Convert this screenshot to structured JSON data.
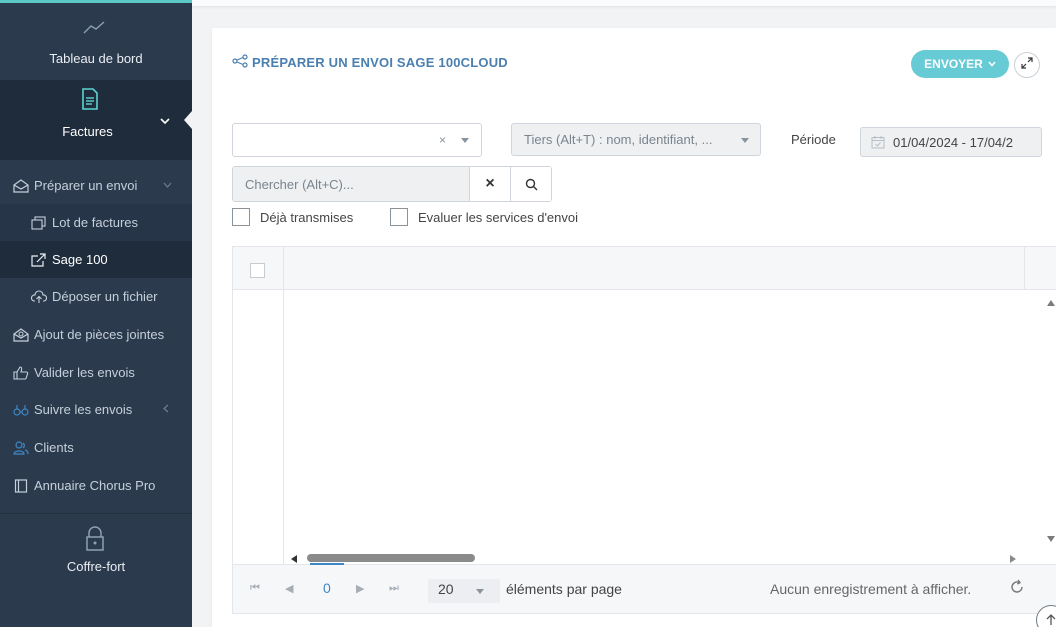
{
  "sidebar": {
    "dashboard_label": "Tableau de bord",
    "factures_label": "Factures",
    "items": [
      {
        "label": "Préparer un envoi",
        "icon": "envelope-open-icon"
      },
      {
        "label": "Lot de factures",
        "icon": "stack-icon"
      },
      {
        "label": "Sage 100",
        "icon": "export-icon"
      },
      {
        "label": "Déposer un fichier",
        "icon": "cloud-upload-icon"
      },
      {
        "label": "Ajout de pièces jointes",
        "icon": "envelope-attach-icon"
      },
      {
        "label": "Valider les envois",
        "icon": "thumb-up-icon"
      },
      {
        "label": "Suivre les envois",
        "icon": "binoculars-icon"
      },
      {
        "label": "Clients",
        "icon": "users-icon"
      },
      {
        "label": "Annuaire Chorus Pro",
        "icon": "book-icon"
      }
    ],
    "vault_label": "Coffre-fort"
  },
  "panel": {
    "title": "PRÉPARER UN ENVOI SAGE 100CLOUD",
    "send_button": "ENVOYER",
    "first_select": {
      "value": "",
      "clear": "×"
    },
    "tiers_placeholder": "Tiers (Alt+T) : nom, identifiant, ...",
    "period_label": "Période",
    "period_value": "01/04/2024 - 17/04/2",
    "search_placeholder": "Chercher (Alt+C)...",
    "search_clear": "×",
    "checkbox_transmitted": "Déjà transmises",
    "checkbox_services": "Evaluer les services d'envoi"
  },
  "pager": {
    "first": "⏮",
    "prev": "◀",
    "current_page": "0",
    "next": "▶",
    "last": "⏭",
    "page_size": "20",
    "per_page_label": "éléments par page",
    "empty_message": "Aucun enregistrement à afficher."
  },
  "colors": {
    "sidebar_bg": "#2b3a4c",
    "sidebar_active": "#1f2c3b",
    "accent": "#67cbd5",
    "title_blue": "#4a7fb0",
    "link_blue": "#3f88c5"
  }
}
